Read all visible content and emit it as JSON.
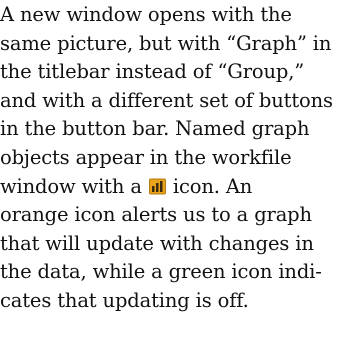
{
  "paragraph": {
    "line_01": "A new window opens with the",
    "line_02": "same picture, but with “Graph” in",
    "line_03": "the titlebar instead of “Group,”",
    "line_04": "and with a different set of buttons",
    "line_05": "in the button bar. Named graph",
    "line_06": "objects appear in the workfile",
    "line_07_before": "window with a",
    "line_07_after": "icon. An",
    "line_08": "orange icon alerts us to a graph",
    "line_09": "that will update with changes in",
    "line_10": "the data, while a green icon indi-",
    "line_11": "cates that updating is off."
  },
  "icons": {
    "inline_icon": "bar-graph-icon",
    "icon_color": "#e8a21c",
    "bar_color": "#3a2a10"
  }
}
